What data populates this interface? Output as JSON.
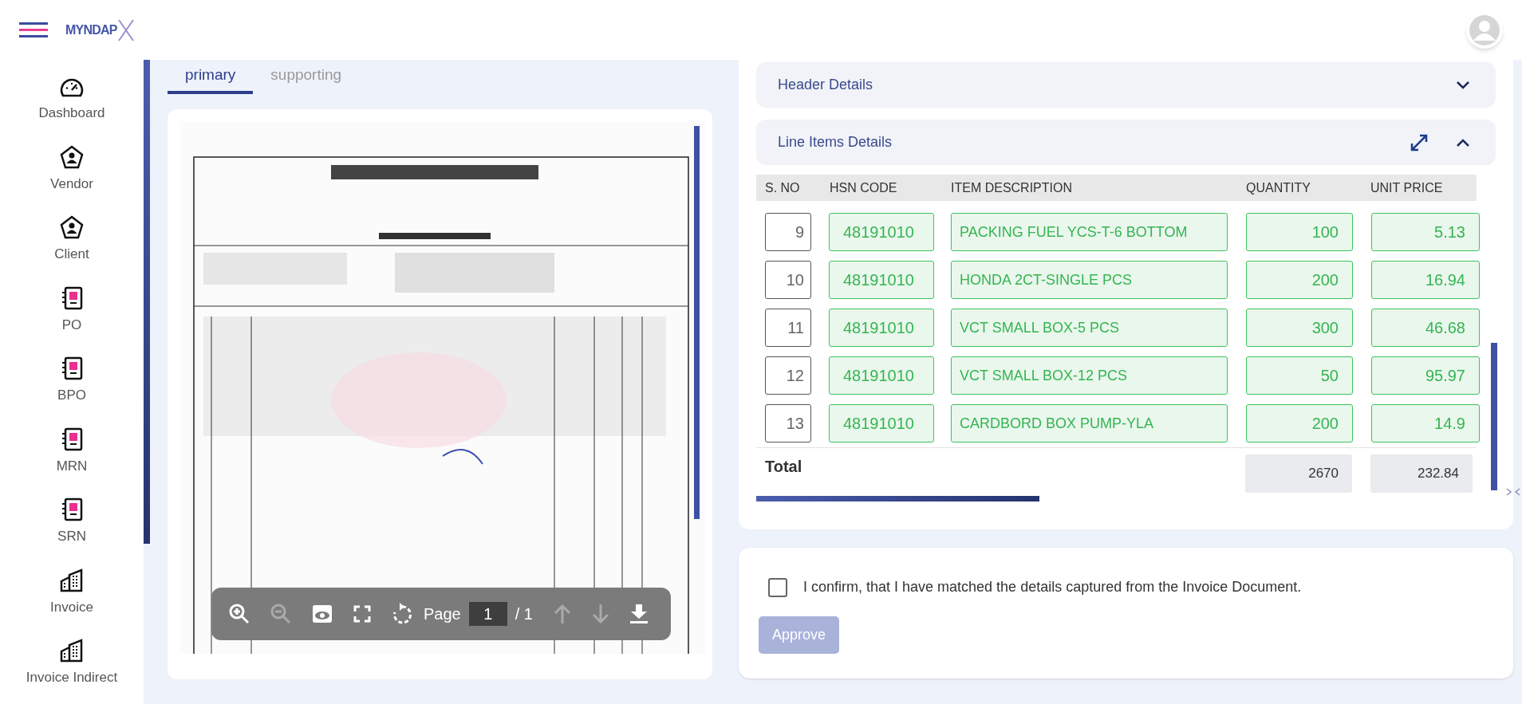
{
  "header": {
    "logo_text": "MYNDAP"
  },
  "sidebar": {
    "items": [
      {
        "label": "Dashboard",
        "kind": "gauge"
      },
      {
        "label": "Vendor",
        "kind": "person"
      },
      {
        "label": "Client",
        "kind": "person"
      },
      {
        "label": "PO",
        "kind": "notebook"
      },
      {
        "label": "BPO",
        "kind": "notebook"
      },
      {
        "label": "MRN",
        "kind": "notebook"
      },
      {
        "label": "SRN",
        "kind": "notebook"
      },
      {
        "label": "Invoice",
        "kind": "building"
      },
      {
        "label": "Invoice Indirect",
        "kind": "building"
      }
    ]
  },
  "tabs": [
    {
      "label": "primary",
      "selected": true
    },
    {
      "label": "supporting",
      "selected": false
    }
  ],
  "viewer": {
    "page_label": "Page",
    "page": "1",
    "page_total": "/ 1"
  },
  "accordions": [
    {
      "title": "Header Details",
      "expanded": false
    },
    {
      "title": "Line Items Details",
      "expanded": true
    }
  ],
  "table": {
    "columns": [
      "S. NO",
      "HSN CODE",
      "ITEM DESCRIPTION",
      "QUANTITY",
      "UNIT PRICE"
    ],
    "rows": [
      {
        "sno": "9",
        "hsn": "48191010",
        "description": "PACKING FUEL YCS-T-6 BOTTOM",
        "quantity": "100",
        "unit_price": "5.13"
      },
      {
        "sno": "10",
        "hsn": "48191010",
        "description": "HONDA 2CT-SINGLE PCS",
        "quantity": "200",
        "unit_price": "16.94"
      },
      {
        "sno": "11",
        "hsn": "48191010",
        "description": "VCT SMALL BOX-5 PCS",
        "quantity": "300",
        "unit_price": "46.68"
      },
      {
        "sno": "12",
        "hsn": "48191010",
        "description": "VCT SMALL BOX-12 PCS",
        "quantity": "50",
        "unit_price": "95.97"
      },
      {
        "sno": "13",
        "hsn": "48191010",
        "description": "CARDBORD BOX PUMP-YLA",
        "quantity": "200",
        "unit_price": "14.9"
      }
    ],
    "total": {
      "label": "Total",
      "quantity": "2670",
      "unit_price": "232.84"
    }
  },
  "confirm": {
    "text": "I confirm, that I have matched the details captured from the Invoice Document.",
    "checked": false
  },
  "approve": {
    "label": "Approve",
    "disabled": true
  }
}
